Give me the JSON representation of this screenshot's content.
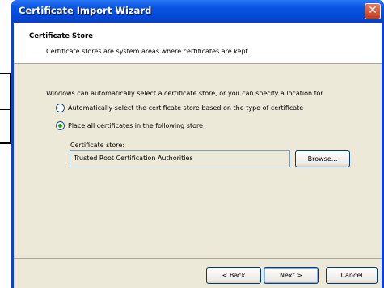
{
  "window": {
    "title": "Certificate Import Wizard",
    "close_glyph": "✕"
  },
  "header": {
    "title": "Certificate Store",
    "description": "Certificate stores are system areas where certificates are kept."
  },
  "body": {
    "intro": "Windows can automatically select a certificate store, or you can specify a location for",
    "options": [
      {
        "label": "Automatically select the certificate store based on the type of certificate",
        "selected": false
      },
      {
        "label": "Place all certificates in the following store",
        "selected": true
      }
    ],
    "store_label": "Certificate store:",
    "store_value": "Trusted Root Certification Authorities",
    "browse_label": "Browse..."
  },
  "footer": {
    "back_label": "< Back",
    "next_label": "Next >",
    "cancel_label": "Cancel"
  },
  "colors": {
    "titlebar": "#0b56e3",
    "dialog_bg": "#ece9d8",
    "radio_dot": "#21a121"
  }
}
